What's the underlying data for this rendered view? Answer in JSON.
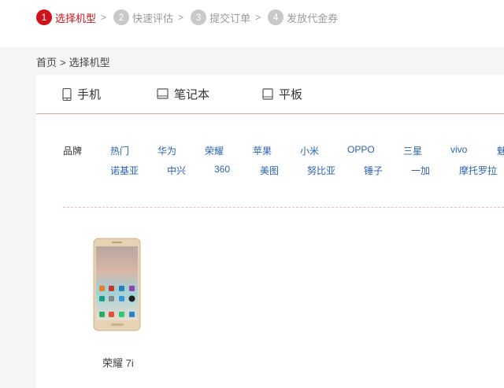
{
  "steps": [
    {
      "num": "1",
      "label": "选择机型"
    },
    {
      "num": "2",
      "label": "快速评估"
    },
    {
      "num": "3",
      "label": "提交订单"
    },
    {
      "num": "4",
      "label": "发放代金券"
    }
  ],
  "step_separator": ">",
  "breadcrumb": {
    "home": "首页",
    "sep": ">",
    "current": "选择机型"
  },
  "tabs": [
    {
      "label": "手机",
      "icon": "phone-icon"
    },
    {
      "label": "笔记本",
      "icon": "laptop-icon"
    },
    {
      "label": "平板",
      "icon": "tablet-icon"
    }
  ],
  "brand_filter": {
    "label": "品牌",
    "row1": [
      "热门",
      "华为",
      "荣耀",
      "苹果",
      "小米",
      "OPPO",
      "三星",
      "vivo",
      "魅"
    ],
    "row2": [
      "诺基亚",
      "中兴",
      "360",
      "美图",
      "努比亚",
      "锤子",
      "一加",
      "摩托罗拉"
    ]
  },
  "products": [
    {
      "name": "荣耀 7i"
    }
  ],
  "colors": {
    "accent": "#d0121a",
    "link": "#2a63b0",
    "inactive_step": "#c9c9c9"
  }
}
